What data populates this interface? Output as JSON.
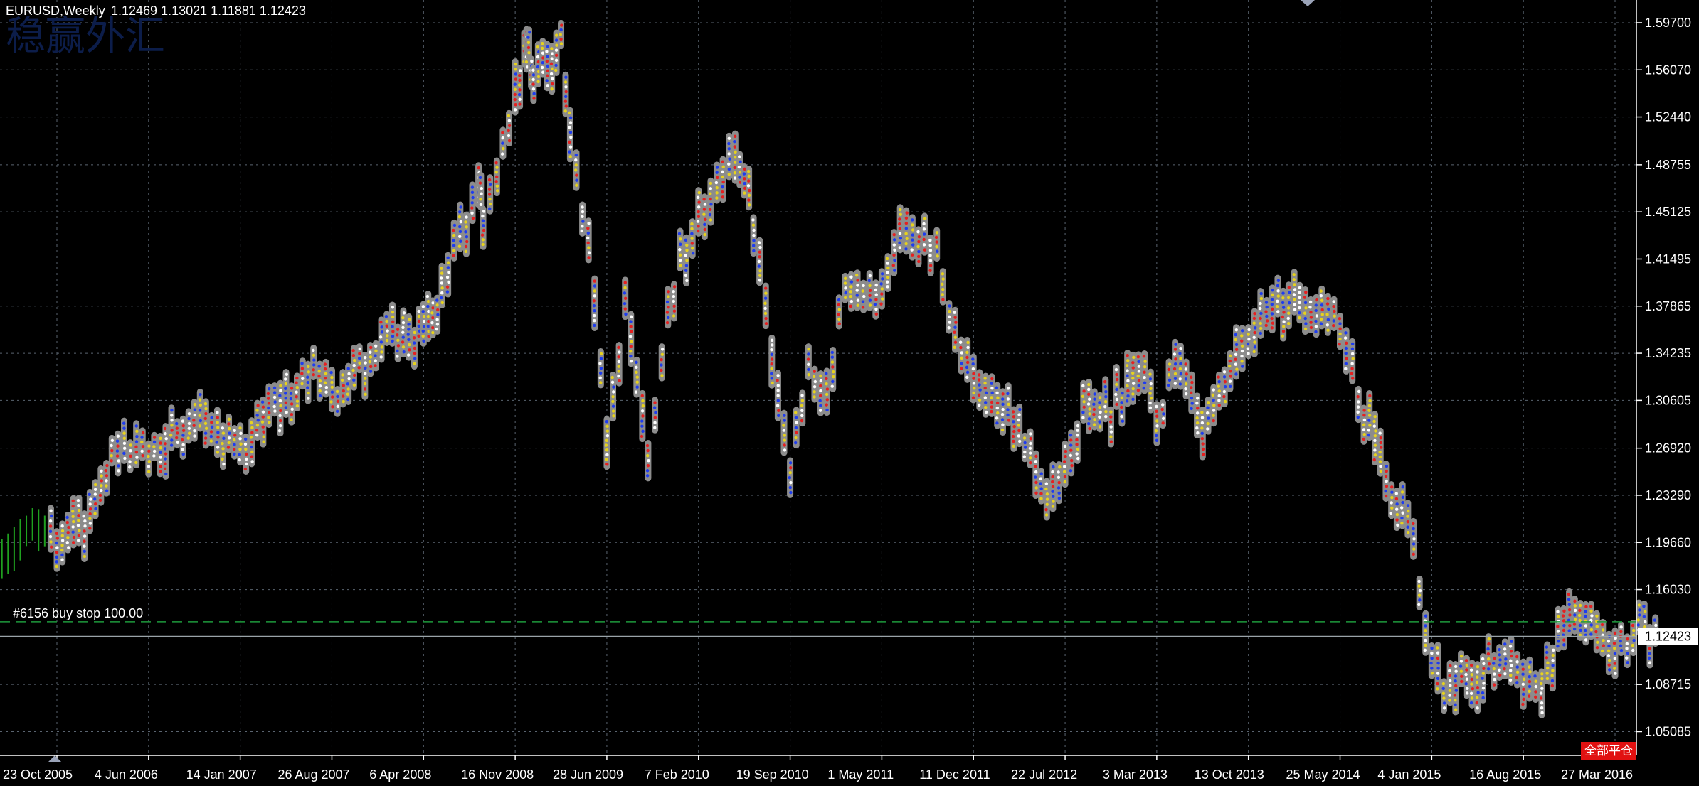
{
  "header": {
    "symbol": "EURUSD,Weekly",
    "ohlc": "1.12469 1.13021 1.11881 1.12423",
    "watermark": "稳赢外汇"
  },
  "order_line": {
    "label": "#6156 buy stop 100.00",
    "price": 1.1355,
    "color": "#1e9a3c"
  },
  "current_price": {
    "value": 1.12423,
    "label": "1.12423",
    "color": "#9aa3a8"
  },
  "close_all_button": {
    "label": "全部平仓",
    "color": "#e11111"
  },
  "colors": {
    "background": "#000000",
    "grid": "#5a6470",
    "candle_up": "#1fa01f",
    "marker_ring": "#8c8c8c",
    "dot_red": "#e62020",
    "dot_blue": "#1e3cf0",
    "dot_yellow": "#e6d21e"
  },
  "chart_data": {
    "type": "candlestick",
    "title": "EURUSD,Weekly",
    "xlabel": "",
    "ylabel": "",
    "grid": true,
    "ylim": [
      1.0325,
      1.6145
    ],
    "y_ticks": [
      "1.59700",
      "1.56070",
      "1.52440",
      "1.48755",
      "1.45125",
      "1.41495",
      "1.37865",
      "1.34235",
      "1.30605",
      "1.26920",
      "1.23290",
      "1.19660",
      "1.16030",
      "1.08715",
      "1.05085"
    ],
    "x_ticks": [
      "23 Oct 2005",
      "4 Jun 2006",
      "14 Jan 2007",
      "26 Aug 2007",
      "6 Apr 2008",
      "16 Nov 2008",
      "28 Jun 2009",
      "7 Feb 2010",
      "19 Sep 2010",
      "1 May 2011",
      "11 Dec 2011",
      "22 Jul 2012",
      "3 Mar 2013",
      "13 Oct 2013",
      "25 May 2014",
      "4 Jan 2015",
      "16 Aug 2015",
      "27 Mar 2016"
    ],
    "x_index_range": [
      0,
      18
    ],
    "series": [
      {
        "x": [
          -0.6,
          -0.2,
          0,
          0.3,
          0.6,
          1,
          1.5,
          2,
          2.5,
          2.8,
          3,
          3.3,
          3.6,
          3.9,
          4,
          4.1,
          4.2,
          4.4,
          4.6,
          4.65,
          4.8,
          5,
          5.1,
          5.15,
          5.2,
          5.3,
          5.4,
          5.5,
          5.6,
          5.8,
          6,
          6.2,
          6.45,
          6.6,
          6.8,
          7,
          7.2,
          7.4,
          7.5,
          7.6,
          7.8,
          8,
          8.2,
          8.4,
          8.6,
          9,
          9.2,
          9.4,
          9.6,
          9.8,
          10,
          10.2,
          10.5,
          10.8,
          11,
          11.2,
          11.5,
          11.8,
          12,
          12.2,
          12.5,
          12.8,
          13,
          13.2,
          13.5,
          13.8,
          14,
          14.2,
          14.5,
          14.8,
          15,
          15.2,
          15.5,
          15.8,
          16,
          16.2,
          16.5,
          16.8,
          17,
          17.2,
          17.5
        ],
        "y": [
          1.19,
          1.205,
          1.195,
          1.21,
          1.27,
          1.265,
          1.29,
          1.27,
          1.31,
          1.325,
          1.31,
          1.33,
          1.36,
          1.35,
          1.375,
          1.36,
          1.4,
          1.43,
          1.47,
          1.45,
          1.48,
          1.54,
          1.575,
          1.58,
          1.55,
          1.57,
          1.56,
          1.58,
          1.5,
          1.43,
          1.28,
          1.38,
          1.27,
          1.34,
          1.41,
          1.44,
          1.48,
          1.5,
          1.48,
          1.44,
          1.33,
          1.25,
          1.33,
          1.31,
          1.39,
          1.39,
          1.445,
          1.42,
          1.42,
          1.36,
          1.32,
          1.3,
          1.29,
          1.23,
          1.26,
          1.3,
          1.3,
          1.33,
          1.29,
          1.33,
          1.29,
          1.33,
          1.36,
          1.38,
          1.385,
          1.375,
          1.37,
          1.31,
          1.25,
          1.2,
          1.1,
          1.08,
          1.095,
          1.11,
          1.08,
          1.09,
          1.14,
          1.13,
          1.105,
          1.13,
          1.12
        ]
      }
    ]
  }
}
